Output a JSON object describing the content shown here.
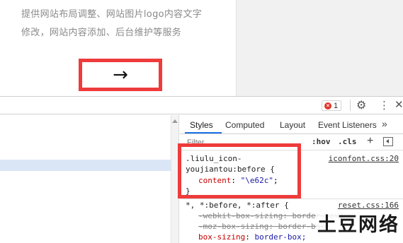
{
  "page": {
    "desc_line1": "提供网站布局调整、网站图片logo内容文字",
    "desc_line2": "修改，网站内容添加、后台维护等服务",
    "arrow_glyph": "→"
  },
  "devtools": {
    "error_count": "1",
    "error_icon": "x-circle-icon",
    "settings_icon": "gear-icon",
    "more_icon": "kebab-menu-icon",
    "close_icon": "close-icon",
    "tabs": [
      {
        "label": "Styles",
        "active": true
      },
      {
        "label": "Computed",
        "active": false
      },
      {
        "label": "Layout",
        "active": false
      },
      {
        "label": "Event Listeners",
        "active": false
      }
    ],
    "tabs_overflow": "»",
    "filter_placeholder": "Filter",
    "hov_label": ":hov",
    "cls_label": ".cls",
    "plus_label": "+",
    "rules": [
      {
        "selector_line1": ".liulu_icon-",
        "selector_line2": "youjiantou:before {",
        "source": "iconfont.css:20",
        "property": "content",
        "value": "\"\\e62c\"",
        "close": "}"
      },
      {
        "selector": "*, *:before, *:after {",
        "source": "reset.css:166",
        "strikethrough_lines": [
          "-webkit-box-sizing: border-box;",
          "-moz-box-sizing: border-box;"
        ],
        "property": "box-sizing",
        "value": "border-box;"
      }
    ]
  },
  "watermark": "土豆网络",
  "colors": {
    "highlight_border": "#ee3b3b",
    "tab_accent": "#1a73e8",
    "property_name": "#c80000",
    "property_value": "#1a1aa6",
    "selected_row": "#dae6f6"
  }
}
